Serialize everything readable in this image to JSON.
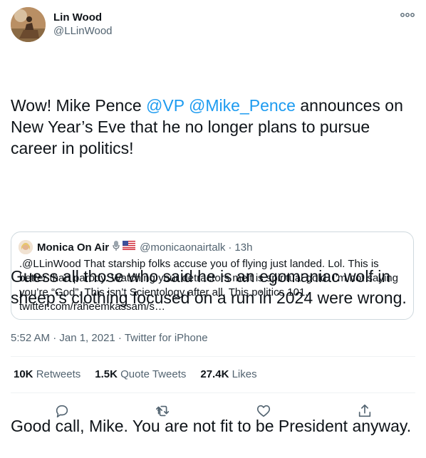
{
  "author": {
    "display_name": "Lin Wood",
    "handle": "@LLinWood"
  },
  "tweet": {
    "paragraphs": [
      {
        "before": "Wow! Mike Pence ",
        "mention1": "@VP",
        "space": " ",
        "mention2": "@Mike_Pence",
        "after": " announces on New Year’s Eve that he no longer plans to pursue career in politics!"
      },
      {
        "text": "Guess all those who said he is an egomaniac wolf in sheep’s clothing focused on a run in 2024 were wrong."
      },
      {
        "text": "Good call, Mike. You are not fit to be President anyway."
      }
    ],
    "timestamp": "5:52 AM · Jan 1, 2021 · Twitter for iPhone"
  },
  "quoted_tweet": {
    "display_name": "Monica On Air",
    "emojis": [
      "microphone-emoji",
      "us-flag-emoji"
    ],
    "handle": "@monicaonairtalk",
    "separator": "·",
    "time": "13h",
    "text": ".@LLinWood That starship folks accuse you of flying just landed. Lol. This is better than parody. Watching your detractors melt is spiritual gold. I’m not saying you’re “God”. This isn’t Scientology after all. This politics 101. twitter.com/raheemkassam/s…"
  },
  "stats": {
    "retweets": {
      "count": "10K",
      "label": "Retweets"
    },
    "quote_tweets": {
      "count": "1.5K",
      "label": "Quote Tweets"
    },
    "likes": {
      "count": "27.4K",
      "label": "Likes"
    }
  },
  "actions": [
    "reply-icon",
    "retweet-icon",
    "like-icon",
    "share-icon"
  ],
  "colors": {
    "accent": "#1d9bf0",
    "text": "#0f1419",
    "secondary": "#536471",
    "border": "#cfd9de"
  }
}
